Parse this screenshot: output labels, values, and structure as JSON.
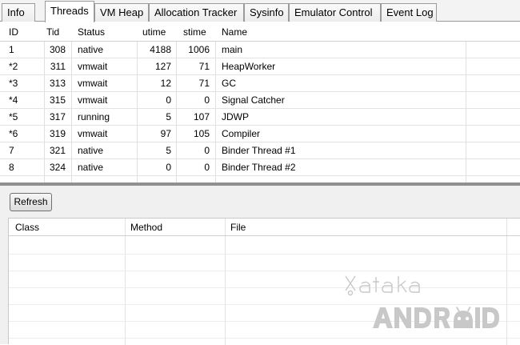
{
  "tabs": [
    {
      "label": "Info",
      "active": false
    },
    {
      "label": "Threads",
      "active": true
    },
    {
      "label": "VM Heap",
      "active": false
    },
    {
      "label": "Allocation Tracker",
      "active": false
    },
    {
      "label": "Sysinfo",
      "active": false
    },
    {
      "label": "Emulator Control",
      "active": false
    },
    {
      "label": "Event Log",
      "active": false
    }
  ],
  "threads": {
    "columns": [
      "ID",
      "Tid",
      "Status",
      "utime",
      "stime",
      "Name"
    ],
    "rows": [
      [
        "1",
        "308",
        "native",
        "4188",
        "1006",
        "main"
      ],
      [
        "*2",
        "311",
        "vmwait",
        "127",
        "71",
        "HeapWorker"
      ],
      [
        "*3",
        "313",
        "vmwait",
        "12",
        "71",
        "GC"
      ],
      [
        "*4",
        "315",
        "vmwait",
        "0",
        "0",
        "Signal Catcher"
      ],
      [
        "*5",
        "317",
        "running",
        "5",
        "107",
        "JDWP"
      ],
      [
        "*6",
        "319",
        "vmwait",
        "97",
        "105",
        "Compiler"
      ],
      [
        "7",
        "321",
        "native",
        "5",
        "0",
        "Binder Thread #1"
      ],
      [
        "8",
        "324",
        "native",
        "0",
        "0",
        "Binder Thread #2"
      ]
    ]
  },
  "lower": {
    "refresh_label": "Refresh",
    "columns": [
      "Class",
      "Method",
      "File"
    ]
  },
  "watermark": {
    "top": "xataka",
    "bottom": "ANDROID"
  }
}
